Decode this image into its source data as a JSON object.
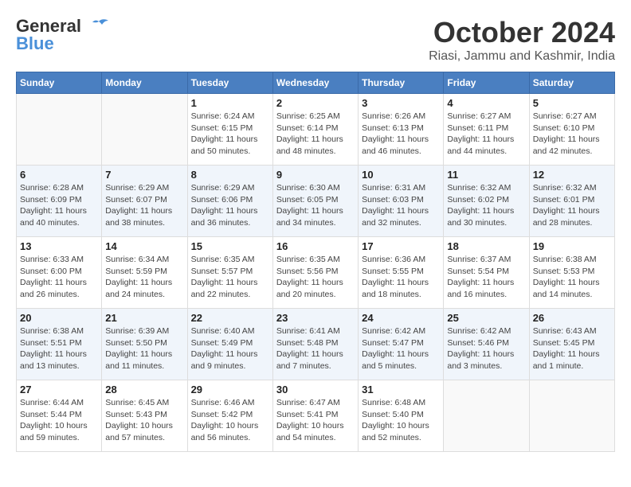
{
  "header": {
    "logo_general": "General",
    "logo_blue": "Blue",
    "month_title": "October 2024",
    "location": "Riasi, Jammu and Kashmir, India"
  },
  "calendar": {
    "days_of_week": [
      "Sunday",
      "Monday",
      "Tuesday",
      "Wednesday",
      "Thursday",
      "Friday",
      "Saturday"
    ],
    "weeks": [
      [
        {
          "day": "",
          "info": ""
        },
        {
          "day": "",
          "info": ""
        },
        {
          "day": "1",
          "info": "Sunrise: 6:24 AM\nSunset: 6:15 PM\nDaylight: 11 hours and 50 minutes."
        },
        {
          "day": "2",
          "info": "Sunrise: 6:25 AM\nSunset: 6:14 PM\nDaylight: 11 hours and 48 minutes."
        },
        {
          "day": "3",
          "info": "Sunrise: 6:26 AM\nSunset: 6:13 PM\nDaylight: 11 hours and 46 minutes."
        },
        {
          "day": "4",
          "info": "Sunrise: 6:27 AM\nSunset: 6:11 PM\nDaylight: 11 hours and 44 minutes."
        },
        {
          "day": "5",
          "info": "Sunrise: 6:27 AM\nSunset: 6:10 PM\nDaylight: 11 hours and 42 minutes."
        }
      ],
      [
        {
          "day": "6",
          "info": "Sunrise: 6:28 AM\nSunset: 6:09 PM\nDaylight: 11 hours and 40 minutes."
        },
        {
          "day": "7",
          "info": "Sunrise: 6:29 AM\nSunset: 6:07 PM\nDaylight: 11 hours and 38 minutes."
        },
        {
          "day": "8",
          "info": "Sunrise: 6:29 AM\nSunset: 6:06 PM\nDaylight: 11 hours and 36 minutes."
        },
        {
          "day": "9",
          "info": "Sunrise: 6:30 AM\nSunset: 6:05 PM\nDaylight: 11 hours and 34 minutes."
        },
        {
          "day": "10",
          "info": "Sunrise: 6:31 AM\nSunset: 6:03 PM\nDaylight: 11 hours and 32 minutes."
        },
        {
          "day": "11",
          "info": "Sunrise: 6:32 AM\nSunset: 6:02 PM\nDaylight: 11 hours and 30 minutes."
        },
        {
          "day": "12",
          "info": "Sunrise: 6:32 AM\nSunset: 6:01 PM\nDaylight: 11 hours and 28 minutes."
        }
      ],
      [
        {
          "day": "13",
          "info": "Sunrise: 6:33 AM\nSunset: 6:00 PM\nDaylight: 11 hours and 26 minutes."
        },
        {
          "day": "14",
          "info": "Sunrise: 6:34 AM\nSunset: 5:59 PM\nDaylight: 11 hours and 24 minutes."
        },
        {
          "day": "15",
          "info": "Sunrise: 6:35 AM\nSunset: 5:57 PM\nDaylight: 11 hours and 22 minutes."
        },
        {
          "day": "16",
          "info": "Sunrise: 6:35 AM\nSunset: 5:56 PM\nDaylight: 11 hours and 20 minutes."
        },
        {
          "day": "17",
          "info": "Sunrise: 6:36 AM\nSunset: 5:55 PM\nDaylight: 11 hours and 18 minutes."
        },
        {
          "day": "18",
          "info": "Sunrise: 6:37 AM\nSunset: 5:54 PM\nDaylight: 11 hours and 16 minutes."
        },
        {
          "day": "19",
          "info": "Sunrise: 6:38 AM\nSunset: 5:53 PM\nDaylight: 11 hours and 14 minutes."
        }
      ],
      [
        {
          "day": "20",
          "info": "Sunrise: 6:38 AM\nSunset: 5:51 PM\nDaylight: 11 hours and 13 minutes."
        },
        {
          "day": "21",
          "info": "Sunrise: 6:39 AM\nSunset: 5:50 PM\nDaylight: 11 hours and 11 minutes."
        },
        {
          "day": "22",
          "info": "Sunrise: 6:40 AM\nSunset: 5:49 PM\nDaylight: 11 hours and 9 minutes."
        },
        {
          "day": "23",
          "info": "Sunrise: 6:41 AM\nSunset: 5:48 PM\nDaylight: 11 hours and 7 minutes."
        },
        {
          "day": "24",
          "info": "Sunrise: 6:42 AM\nSunset: 5:47 PM\nDaylight: 11 hours and 5 minutes."
        },
        {
          "day": "25",
          "info": "Sunrise: 6:42 AM\nSunset: 5:46 PM\nDaylight: 11 hours and 3 minutes."
        },
        {
          "day": "26",
          "info": "Sunrise: 6:43 AM\nSunset: 5:45 PM\nDaylight: 11 hours and 1 minute."
        }
      ],
      [
        {
          "day": "27",
          "info": "Sunrise: 6:44 AM\nSunset: 5:44 PM\nDaylight: 10 hours and 59 minutes."
        },
        {
          "day": "28",
          "info": "Sunrise: 6:45 AM\nSunset: 5:43 PM\nDaylight: 10 hours and 57 minutes."
        },
        {
          "day": "29",
          "info": "Sunrise: 6:46 AM\nSunset: 5:42 PM\nDaylight: 10 hours and 56 minutes."
        },
        {
          "day": "30",
          "info": "Sunrise: 6:47 AM\nSunset: 5:41 PM\nDaylight: 10 hours and 54 minutes."
        },
        {
          "day": "31",
          "info": "Sunrise: 6:48 AM\nSunset: 5:40 PM\nDaylight: 10 hours and 52 minutes."
        },
        {
          "day": "",
          "info": ""
        },
        {
          "day": "",
          "info": ""
        }
      ]
    ]
  }
}
